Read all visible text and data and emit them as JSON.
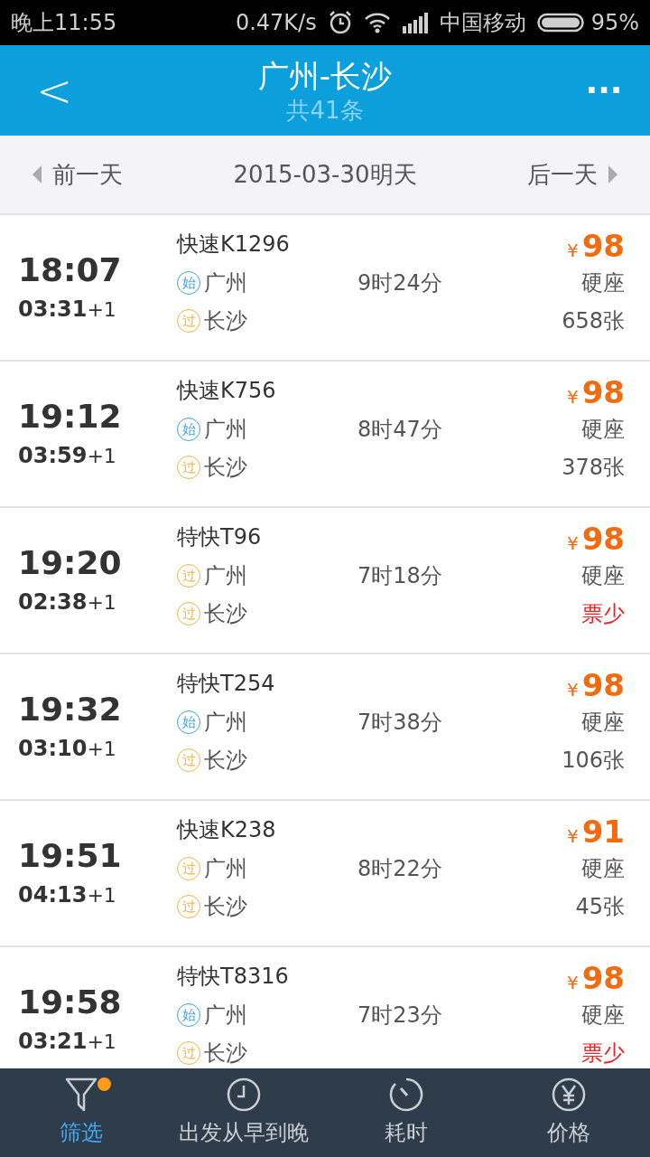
{
  "status_bar": {
    "time": "晚上11:55",
    "speed": "0.47K/s",
    "carrier": "中国移动",
    "battery": "95%"
  },
  "header": {
    "back": "<",
    "title": "广州-长沙",
    "subtitle": "共41条",
    "more": "···"
  },
  "date_bar": {
    "prev": "前一天",
    "date": "2015-03-30明天",
    "next": "后一天"
  },
  "trains": [
    {
      "depart": "18:07",
      "arrive": "03:31",
      "day": "+1",
      "name": "快速K1296",
      "from": {
        "badge": "始",
        "kind": "start",
        "name": "广州"
      },
      "to": {
        "badge": "过",
        "kind": "pass",
        "name": "长沙"
      },
      "duration": "9时24分",
      "currency": "¥",
      "price": "98",
      "seat": "硬座",
      "tickets": "658张",
      "few": false
    },
    {
      "depart": "19:12",
      "arrive": "03:59",
      "day": "+1",
      "name": "快速K756",
      "from": {
        "badge": "始",
        "kind": "start",
        "name": "广州"
      },
      "to": {
        "badge": "过",
        "kind": "pass",
        "name": "长沙"
      },
      "duration": "8时47分",
      "currency": "¥",
      "price": "98",
      "seat": "硬座",
      "tickets": "378张",
      "few": false
    },
    {
      "depart": "19:20",
      "arrive": "02:38",
      "day": "+1",
      "name": "特快T96",
      "from": {
        "badge": "过",
        "kind": "pass",
        "name": "广州"
      },
      "to": {
        "badge": "过",
        "kind": "pass",
        "name": "长沙"
      },
      "duration": "7时18分",
      "currency": "¥",
      "price": "98",
      "seat": "硬座",
      "tickets": "票少",
      "few": true
    },
    {
      "depart": "19:32",
      "arrive": "03:10",
      "day": "+1",
      "name": "特快T254",
      "from": {
        "badge": "始",
        "kind": "start",
        "name": "广州"
      },
      "to": {
        "badge": "过",
        "kind": "pass",
        "name": "长沙"
      },
      "duration": "7时38分",
      "currency": "¥",
      "price": "98",
      "seat": "硬座",
      "tickets": "106张",
      "few": false
    },
    {
      "depart": "19:51",
      "arrive": "04:13",
      "day": "+1",
      "name": "快速K238",
      "from": {
        "badge": "过",
        "kind": "pass",
        "name": "广州"
      },
      "to": {
        "badge": "过",
        "kind": "pass",
        "name": "长沙"
      },
      "duration": "8时22分",
      "currency": "¥",
      "price": "91",
      "seat": "硬座",
      "tickets": "45张",
      "few": false
    },
    {
      "depart": "19:58",
      "arrive": "03:21",
      "day": "+1",
      "name": "特快T8316",
      "from": {
        "badge": "始",
        "kind": "start",
        "name": "广州"
      },
      "to": {
        "badge": "过",
        "kind": "pass",
        "name": "长沙"
      },
      "duration": "7时23分",
      "currency": "¥",
      "price": "98",
      "seat": "硬座",
      "tickets": "票少",
      "few": true
    }
  ],
  "tab_bar": [
    {
      "kind": "filter",
      "label": "筛选",
      "selected": true,
      "dot": true
    },
    {
      "kind": "clock",
      "label": "出发从早到晚",
      "selected": false,
      "dot": false
    },
    {
      "kind": "timer",
      "label": "耗时",
      "selected": false,
      "dot": false
    },
    {
      "kind": "yen",
      "label": "价格",
      "selected": false,
      "dot": false
    }
  ]
}
